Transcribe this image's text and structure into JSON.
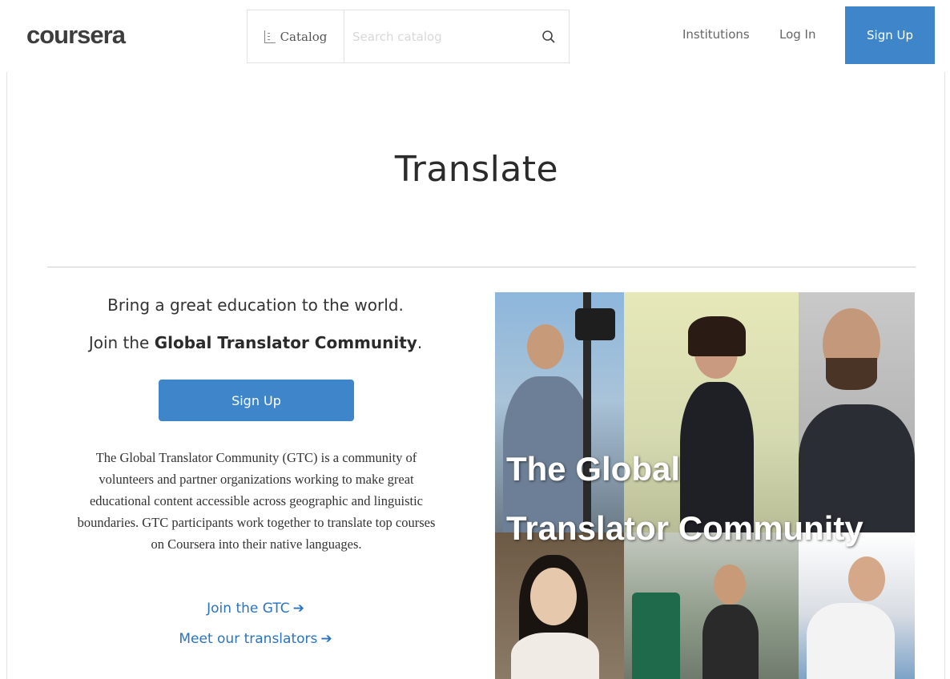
{
  "header": {
    "logo": "coursera",
    "catalog_label": "Catalog",
    "search_placeholder": "Search catalog",
    "nav": {
      "institutions": "Institutions",
      "login": "Log In",
      "signup": "Sign Up"
    }
  },
  "main": {
    "title": "Translate",
    "tagline_line1": "Bring a great education to the world.",
    "tagline_line2_prefix": "Join the ",
    "tagline_line2_bold": "Global Translator Community",
    "tagline_line2_suffix": ".",
    "signup_button": "Sign Up",
    "description": "The Global Translator Community (GTC) is a community of volunteers and partner organizations working to make great educational content accessible across geographic and linguistic boundaries. GTC participants work together to translate top courses on Coursera into their native languages.",
    "links": {
      "join_gtc": "Join the GTC",
      "meet_translators": "Meet our translators"
    },
    "collage": {
      "title_line1": "The Global",
      "title_line2": "Translator Community"
    }
  },
  "colors": {
    "accent": "#3e86c9",
    "link": "#2a73c0"
  },
  "icons": {
    "catalog": "catalog-icon",
    "search": "search-icon",
    "arrow": "arrow-right-icon"
  }
}
